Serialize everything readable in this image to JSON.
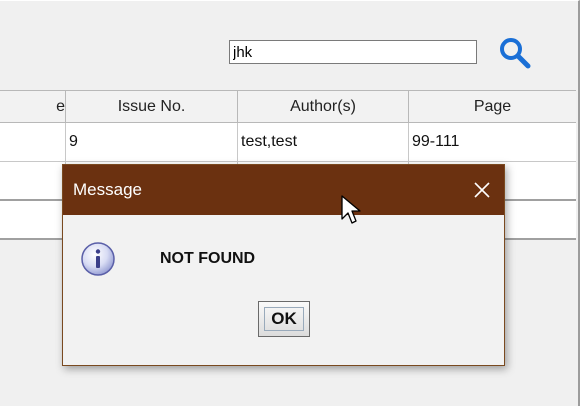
{
  "search": {
    "value": "jhk",
    "icon": "search-icon",
    "accent_color": "#1a6fd6"
  },
  "table": {
    "columns": [
      "e",
      "Issue No.",
      "Author(s)",
      "Page"
    ],
    "rows": [
      [
        "",
        "9",
        "test,test",
        "99-111"
      ]
    ]
  },
  "dialog": {
    "title": "Message",
    "close_glyph": "✕",
    "message": "NOT FOUND",
    "ok_label": "OK",
    "icon": "info-icon",
    "titlebar_color": "#6b3110"
  }
}
